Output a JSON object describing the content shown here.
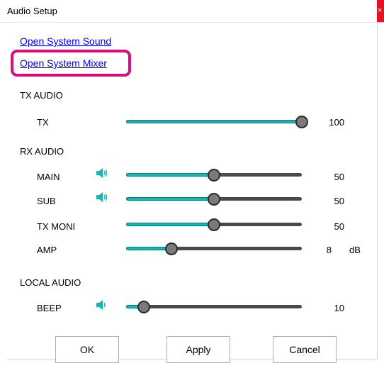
{
  "window": {
    "title": "Audio Setup",
    "close_glyph": "×"
  },
  "links": {
    "open_system_sound": "Open System Sound",
    "open_system_mixer": "Open System Mixer"
  },
  "highlight_color": "#d4107c",
  "accent_color": "#1ab4b4",
  "sections": {
    "tx_audio": "TX AUDIO",
    "rx_audio": "RX AUDIO",
    "local_audio": "LOCAL AUDIO"
  },
  "controls": [
    {
      "label": "TX",
      "value": "100",
      "level": 1.0,
      "unit": "",
      "speaker_icon": false
    },
    {
      "label": "MAIN",
      "value": "50",
      "level": 0.5,
      "unit": "",
      "speaker_icon": true,
      "icon": "speaker-icon"
    },
    {
      "label": "SUB",
      "value": "50",
      "level": 0.5,
      "unit": "",
      "speaker_icon": true,
      "icon": "speaker-icon"
    },
    {
      "label": "TX MONI",
      "value": "50",
      "level": 0.5,
      "unit": "",
      "speaker_icon": false
    },
    {
      "label": "AMP",
      "value": "8",
      "level": 0.26,
      "unit": "dB",
      "speaker_icon": false
    },
    {
      "label": "BEEP",
      "value": "10",
      "level": 0.1,
      "unit": "",
      "speaker_icon": true,
      "icon": "speaker-low-icon"
    }
  ],
  "buttons": {
    "ok": "OK",
    "apply": "Apply",
    "cancel": "Cancel"
  }
}
